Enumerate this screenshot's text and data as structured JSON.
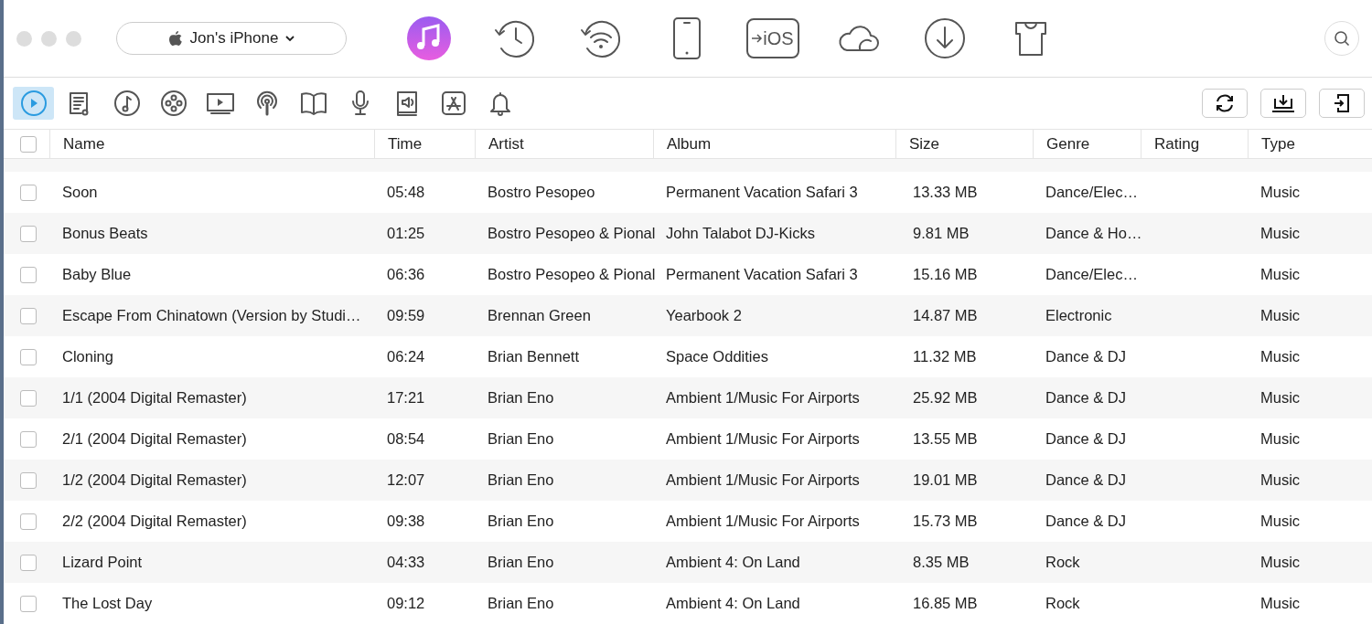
{
  "device_selector": {
    "label": "Jon's iPhone"
  },
  "top_nav": [
    {
      "kind": "music",
      "selected": true
    },
    {
      "kind": "history",
      "selected": false
    },
    {
      "kind": "wifi-history",
      "selected": false
    },
    {
      "kind": "phone",
      "selected": false
    },
    {
      "kind": "ios",
      "label": "iOS",
      "selected": false
    },
    {
      "kind": "cloud",
      "selected": false
    },
    {
      "kind": "download",
      "selected": false
    },
    {
      "kind": "shirt",
      "selected": false
    }
  ],
  "categories": [
    {
      "kind": "play",
      "selected": true
    },
    {
      "kind": "playlist",
      "selected": false
    },
    {
      "kind": "note",
      "selected": false
    },
    {
      "kind": "film",
      "selected": false
    },
    {
      "kind": "tv",
      "selected": false
    },
    {
      "kind": "podcast",
      "selected": false
    },
    {
      "kind": "book",
      "selected": false
    },
    {
      "kind": "mic",
      "selected": false
    },
    {
      "kind": "audiobook",
      "selected": false
    },
    {
      "kind": "appstore",
      "selected": false
    },
    {
      "kind": "bell",
      "selected": false
    }
  ],
  "actions": [
    {
      "kind": "refresh"
    },
    {
      "kind": "import"
    },
    {
      "kind": "export"
    }
  ],
  "table": {
    "select_all": {
      "checked": false
    },
    "columns": [
      "Name",
      "Time",
      "Artist",
      "Album",
      "Size",
      "Genre",
      "Rating",
      "Type"
    ],
    "rows": [
      {
        "checked": false,
        "cells": [
          "Soon",
          "05:48",
          "Bostro Pesopeo",
          "Permanent Vacation Safari 3",
          "13.33 MB",
          "Dance/Elec…",
          "",
          "Music"
        ]
      },
      {
        "checked": false,
        "cells": [
          "Bonus Beats",
          "01:25",
          "Bostro Pesopeo & Pional",
          "John Talabot DJ-Kicks",
          "9.81 MB",
          "Dance & Ho…",
          "",
          "Music"
        ]
      },
      {
        "checked": false,
        "cells": [
          "Baby Blue",
          "06:36",
          "Bostro Pesopeo & Pional",
          "Permanent Vacation Safari 3",
          "15.16 MB",
          "Dance/Elec…",
          "",
          "Music"
        ]
      },
      {
        "checked": false,
        "cells": [
          "Escape From Chinatown (Version by Studi…",
          "09:59",
          "Brennan Green",
          "Yearbook 2",
          "14.87 MB",
          "Electronic",
          "",
          "Music"
        ]
      },
      {
        "checked": false,
        "cells": [
          "Cloning",
          "06:24",
          "Brian Bennett",
          "Space Oddities",
          "11.32 MB",
          "Dance & DJ",
          "",
          "Music"
        ]
      },
      {
        "checked": false,
        "cells": [
          "1/1 (2004 Digital Remaster)",
          "17:21",
          "Brian Eno",
          "Ambient 1/Music For Airports",
          "25.92 MB",
          "Dance & DJ",
          "",
          "Music"
        ]
      },
      {
        "checked": false,
        "cells": [
          "2/1 (2004 Digital Remaster)",
          "08:54",
          "Brian Eno",
          "Ambient 1/Music For Airports",
          "13.55 MB",
          "Dance & DJ",
          "",
          "Music"
        ]
      },
      {
        "checked": false,
        "cells": [
          "1/2 (2004 Digital Remaster)",
          "12:07",
          "Brian Eno",
          "Ambient 1/Music For Airports",
          "19.01 MB",
          "Dance & DJ",
          "",
          "Music"
        ]
      },
      {
        "checked": false,
        "cells": [
          "2/2 (2004 Digital Remaster)",
          "09:38",
          "Brian Eno",
          "Ambient 1/Music For Airports",
          "15.73 MB",
          "Dance & DJ",
          "",
          "Music"
        ]
      },
      {
        "checked": false,
        "cells": [
          "Lizard Point",
          "04:33",
          "Brian Eno",
          "Ambient 4: On Land",
          "8.35 MB",
          "Rock",
          "",
          "Music"
        ]
      },
      {
        "checked": false,
        "cells": [
          "The Lost Day",
          "09:12",
          "Brian Eno",
          "Ambient 4: On Land",
          "16.85 MB",
          "Rock",
          "",
          "Music"
        ]
      }
    ]
  }
}
